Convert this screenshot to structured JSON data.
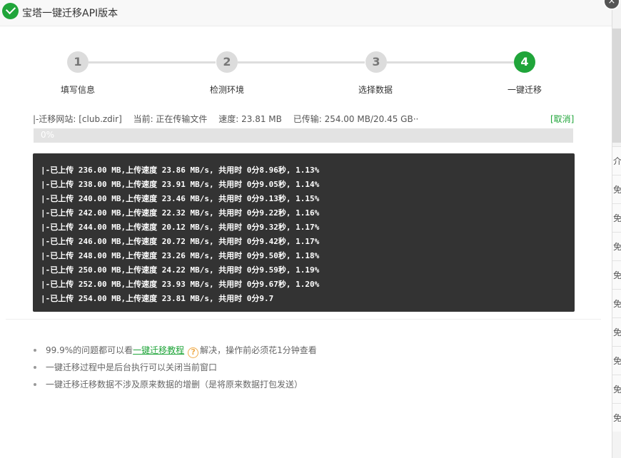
{
  "dialog": {
    "title": "宝塔一键迁移API版本",
    "close_glyph": "×"
  },
  "steps": [
    {
      "number": "1",
      "label": "填写信息"
    },
    {
      "number": "2",
      "label": "检测环境"
    },
    {
      "number": "3",
      "label": "选择数据"
    },
    {
      "number": "4",
      "label": "一键迁移"
    }
  ],
  "active_step": 4,
  "status": {
    "site": "|-迁移网站: [club.zdir]",
    "current": "当前: 正在传输文件",
    "speed": "速度: 23.81 MB",
    "transferred": "已传输: 254.00 MB/20.45 GB··",
    "cancel": "[取消]"
  },
  "progress": {
    "percent": 0,
    "label": "0%"
  },
  "log": [
    "|-已上传 236.00 MB,上传速度 23.86 MB/s, 共用时 0分8.96秒,  1.13%",
    "|-已上传 238.00 MB,上传速度 23.91 MB/s, 共用时 0分9.05秒,  1.14%",
    "|-已上传 240.00 MB,上传速度 23.46 MB/s, 共用时 0分9.13秒,  1.15%",
    "|-已上传 242.00 MB,上传速度 22.32 MB/s, 共用时 0分9.22秒,  1.16%",
    "|-已上传 244.00 MB,上传速度 20.12 MB/s, 共用时 0分9.32秒,  1.17%",
    "|-已上传 246.00 MB,上传速度 20.72 MB/s, 共用时 0分9.42秒,  1.17%",
    "|-已上传 248.00 MB,上传速度 23.26 MB/s, 共用时 0分9.50秒,  1.18%",
    "|-已上传 250.00 MB,上传速度 24.22 MB/s, 共用时 0分9.59秒,  1.19%",
    "|-已上传 252.00 MB,上传速度 23.93 MB/s, 共用时 0分9.67秒,  1.20%",
    "|-已上传 254.00 MB,上传速度 23.81 MB/s, 共用时 0分9.7"
  ],
  "tips": {
    "tip1_prefix": "99.9%的问题都可以看",
    "tip1_link": "一键迁移教程",
    "tip1_help_glyph": "?",
    "tip1_suffix": "解决，操作前必须花1分钟查看",
    "tip2": "一键迁移过程中是后台执行可以关闭当前窗口",
    "tip3": "一键迁移迁移数据不涉及原来数据的增删（是将原来数据打包发送）"
  },
  "background": {
    "header_fragment": "介格",
    "row_fragment": "免费"
  },
  "colors": {
    "accent": "#20a53a",
    "console_bg": "#333333",
    "help_icon": "#f0ad4e"
  }
}
